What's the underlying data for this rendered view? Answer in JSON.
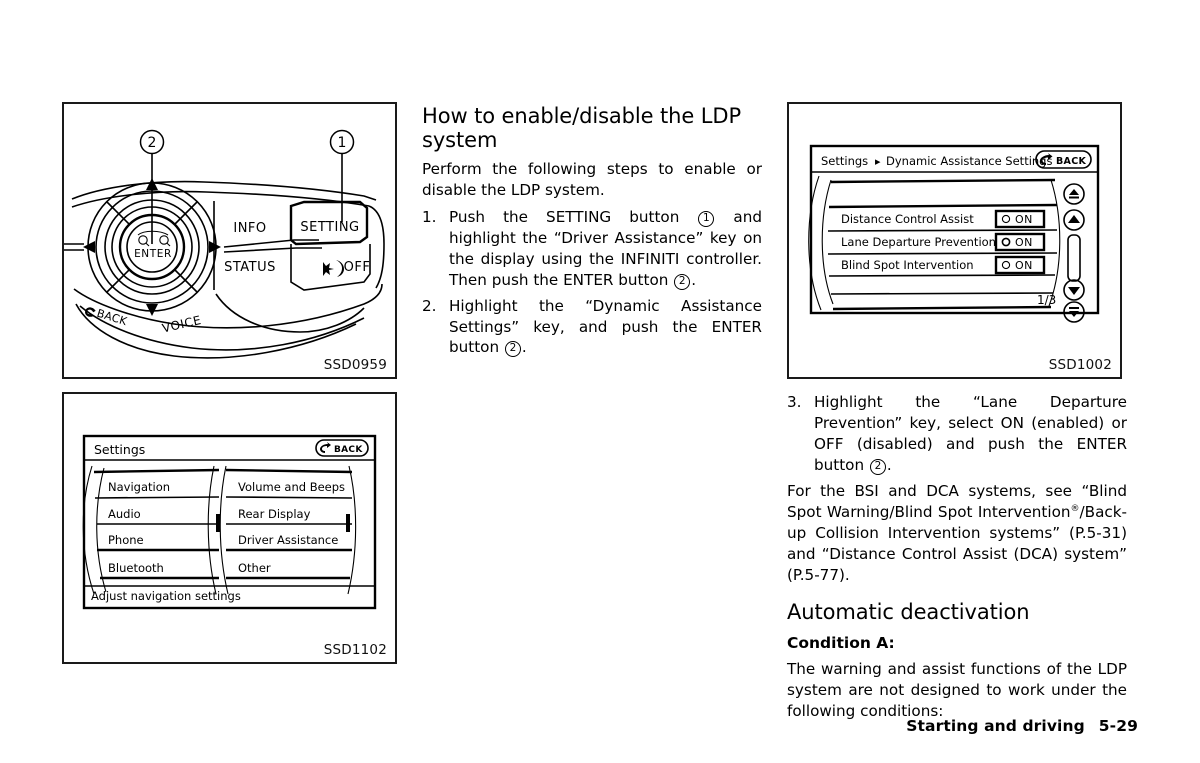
{
  "page": {
    "footer_section": "Starting and driving",
    "footer_page": "5-29"
  },
  "figures": {
    "controller": {
      "caption": "SSD0959",
      "callouts": [
        "2",
        "1"
      ],
      "labels": {
        "info": "INFO",
        "setting": "SETTING",
        "status": "STATUS",
        "day_night_off": "OFF",
        "enter": "ENTER",
        "back": "BACK",
        "voice": "VOICE"
      }
    },
    "settings_menu": {
      "caption": "SSD1102",
      "title": "Settings",
      "back_label": "BACK",
      "items_left": [
        "Navigation",
        "Audio",
        "Phone",
        "Bluetooth"
      ],
      "items_right": [
        "Volume and Beeps",
        "Rear Display",
        "Driver Assistance",
        "Other"
      ],
      "status_bar": "Adjust navigation settings"
    },
    "dynamic_assistance": {
      "caption": "SSD1002",
      "breadcrumb_root": "Settings",
      "breadcrumb_sep": "▸",
      "breadcrumb_leaf": "Dynamic Assistance Settings",
      "back_label": "BACK",
      "rows": [
        {
          "label": "Distance Control Assist",
          "value": "ON"
        },
        {
          "label": "Lane Departure Prevention",
          "value": "ON"
        },
        {
          "label": "Blind Spot Intervention",
          "value": "ON"
        }
      ],
      "page_indicator": "1/3"
    }
  },
  "middle_column": {
    "heading": "How to enable/disable the LDP system",
    "intro": "Perform the following steps to enable or disable the LDP system.",
    "steps": [
      {
        "num": "1.",
        "part1": "Push the SETTING button",
        "circle1": "1",
        "part2": "and highlight the “Driver Assistance” key on the display using the INFINITI controller. Then push the ENTER button",
        "circle2": "2",
        "part3": "."
      },
      {
        "num": "2.",
        "part1": "Highlight the “Dynamic Assistance Settings” key, and push the ENTER button",
        "circle1": "2",
        "part2": ".",
        "circle2": "",
        "part3": ""
      }
    ]
  },
  "right_column": {
    "step3": {
      "num": "3.",
      "part1": "Highlight the “Lane Departure Prevention” key, select ON (enabled) or OFF (disabled) and push the ENTER button",
      "circle1": "2",
      "part2": "."
    },
    "reference_paragraph_a": "For the BSI and DCA systems, see “Blind Spot Warning/Blind Spot Intervention",
    "reference_registered": "®",
    "reference_paragraph_b": "/Back-up Collision Intervention systems” (P.5-31) and “Distance Control Assist (DCA) system” (P.5-77).",
    "heading_auto_deactivation": "Automatic deactivation",
    "subheading_condition_a": "Condition A:",
    "condition_a_body": "The warning and assist functions of the LDP system are not designed to work under the following conditions:"
  }
}
